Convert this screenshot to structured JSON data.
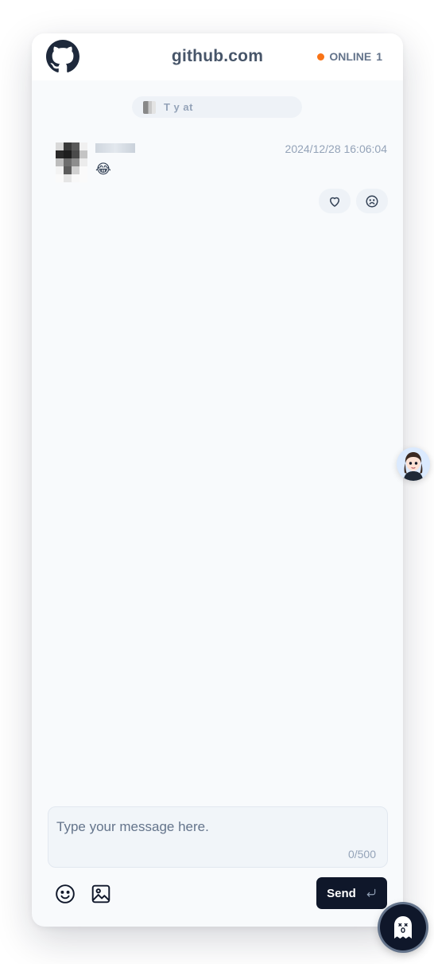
{
  "header": {
    "title": "github.com",
    "status_label": "ONLINE",
    "online_count": "1",
    "status_color": "#f97316",
    "logo_icon": "github-icon"
  },
  "room": {
    "name": "T        y          at"
  },
  "messages": [
    {
      "author": "",
      "time": "2024/12/28 16:06:04",
      "text": "😂",
      "reactions": [
        "heart-icon",
        "sad-face-icon"
      ]
    }
  ],
  "composer": {
    "placeholder": "Type your message here.",
    "counter": "0/500",
    "send_label": "Send",
    "send_icon": "enter-icon"
  },
  "toolbar": {
    "emoji_icon": "smile-icon",
    "image_icon": "image-icon"
  },
  "colors": {
    "accent": "#0f172a",
    "panel_bg": "#f8fafc"
  }
}
